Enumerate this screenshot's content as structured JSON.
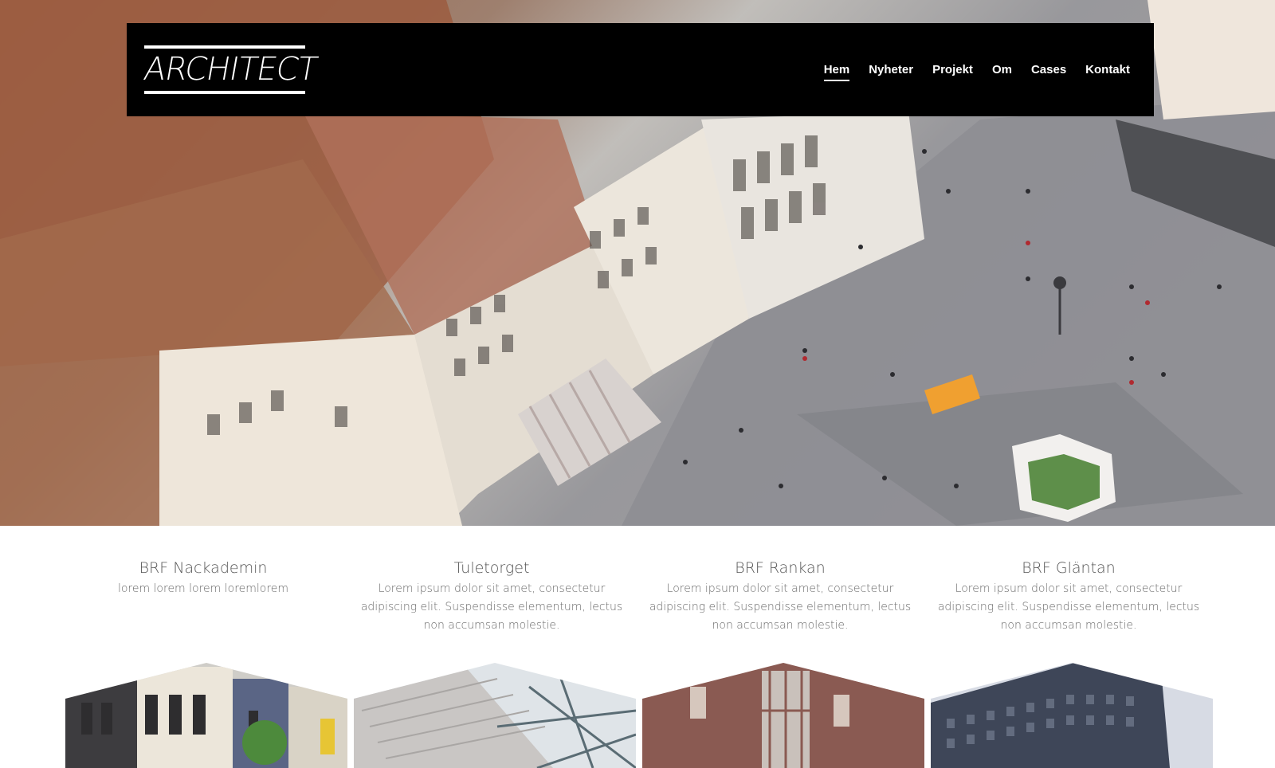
{
  "header": {
    "logo_text": "ARCHITECT",
    "nav": [
      {
        "label": "Hem",
        "active": true
      },
      {
        "label": "Nyheter",
        "active": false
      },
      {
        "label": "Projekt",
        "active": false
      },
      {
        "label": "Om",
        "active": false
      },
      {
        "label": "Cases",
        "active": false
      },
      {
        "label": "Kontakt",
        "active": false
      }
    ]
  },
  "features": [
    {
      "title": "BRF Nackademin",
      "text": "lorem lorem lorem loremlorem"
    },
    {
      "title": "Tuletorget",
      "text": "Lorem ipsum dolor sit amet, consectetur adipiscing elit. Suspendisse elementum, lectus non accumsan molestie."
    },
    {
      "title": "BRF Rankan",
      "text": "Lorem ipsum dolor sit amet, consectetur adipiscing elit. Suspendisse elementum, lectus non accumsan molestie."
    },
    {
      "title": "BRF Gläntan",
      "text": "Lorem ipsum dolor sit amet, consectetur adipiscing elit. Suspendisse elementum, lectus non accumsan molestie."
    }
  ],
  "colors": {
    "navbar_bg": "#000000",
    "nav_text": "#ffffff",
    "heading_text": "#555555",
    "body_text": "#6b6b6b"
  }
}
